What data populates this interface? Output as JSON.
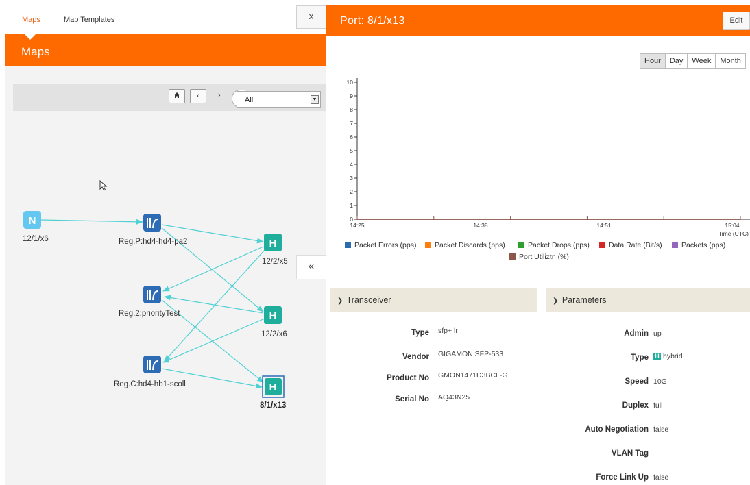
{
  "nav": {
    "tabs": [
      {
        "label": "Maps"
      },
      {
        "label": "Map Templates"
      }
    ]
  },
  "maps_header": {
    "title": "Maps"
  },
  "map_toolbar": {
    "home_icon": "home-icon",
    "prev_icon": "chevron-left-icon",
    "next_icon": "chevron-right-icon",
    "filter_value": "All"
  },
  "map": {
    "nodes": [
      {
        "label": "12/1/x6",
        "letter": "N",
        "kind": "network"
      },
      {
        "label": "Reg.P:hd4-hd4-pa2",
        "kind": "gigasmart"
      },
      {
        "label": "12/2/x5",
        "letter": "H",
        "kind": "hybrid"
      },
      {
        "label": "Reg.2:priorityTest",
        "kind": "gigasmart"
      },
      {
        "label": "12/2/x6",
        "letter": "H",
        "kind": "hybrid"
      },
      {
        "label": "Reg.C:hd4-hb1-scoll",
        "kind": "gigasmart"
      },
      {
        "label": "8/1/x13",
        "letter": "H",
        "kind": "hybrid",
        "selected": true
      }
    ],
    "colors": {
      "network": "#63c7f0",
      "gigasmart": "#2d6bb5",
      "hybrid": "#1fae9b",
      "edge": "#4fd1d4"
    }
  },
  "close_label": "x",
  "collapse_label": "«",
  "port_panel": {
    "title": "Port: 8/1/x13",
    "edit_label": "Edit",
    "ranges": [
      {
        "label": "Hour",
        "active": true
      },
      {
        "label": "Day"
      },
      {
        "label": "Week"
      },
      {
        "label": "Month"
      }
    ]
  },
  "chart_data": {
    "type": "line",
    "title": "",
    "xlabel": "Time (UTC)",
    "ylabel": "",
    "ylim": [
      0,
      10
    ],
    "y_ticks": [
      "0",
      "1",
      "2",
      "3",
      "4",
      "5",
      "6",
      "7",
      "8",
      "9",
      "10"
    ],
    "x_ticks": [
      "14:25",
      "14:38",
      "14:51",
      "15:04"
    ],
    "series": [
      {
        "name": "Packet Errors (pps)",
        "color": "#2b6cb0",
        "values": [
          0,
          0,
          0,
          0,
          0,
          0,
          0,
          0,
          0,
          0,
          0
        ]
      },
      {
        "name": "Packet Discards (pps)",
        "color": "#ff7f0e",
        "values": [
          0,
          0,
          0,
          0,
          0,
          0,
          0,
          0,
          0,
          0,
          0
        ]
      },
      {
        "name": "Packet Drops (pps)",
        "color": "#2ca02c",
        "values": [
          0,
          0,
          0,
          0,
          0,
          0,
          0,
          0,
          0,
          0,
          0
        ]
      },
      {
        "name": "Data Rate (Bit/s)",
        "color": "#d62728",
        "values": [
          0,
          0,
          0,
          0,
          0,
          0,
          0,
          0,
          0,
          0,
          0
        ]
      },
      {
        "name": "Packets (pps)",
        "color": "#9467bd",
        "values": [
          0,
          0,
          0,
          0,
          0,
          0,
          0,
          0,
          0,
          0,
          0
        ]
      },
      {
        "name": "Port Utiliztn (%)",
        "color": "#8c564b",
        "values": [
          0,
          0,
          0,
          0,
          0,
          0,
          0,
          0,
          0,
          0,
          0
        ]
      }
    ]
  },
  "transceiver": {
    "title": "Transceiver",
    "fields": [
      {
        "key": "Type",
        "value": "sfp+ lr"
      },
      {
        "key": "Vendor",
        "value": "GIGAMON SFP-533"
      },
      {
        "key": "Product No",
        "value": "GMON1471D3BCL-G"
      },
      {
        "key": "Serial No",
        "value": "AQ43N25"
      }
    ]
  },
  "parameters": {
    "title": "Parameters",
    "fields": [
      {
        "key": "Admin",
        "value": "up"
      },
      {
        "key": "Type",
        "value": "hybrid",
        "badge": "H"
      },
      {
        "key": "Speed",
        "value": "10G"
      },
      {
        "key": "Duplex",
        "value": "full"
      },
      {
        "key": "Auto Negotiation",
        "value": "false"
      },
      {
        "key": "VLAN Tag",
        "value": ""
      },
      {
        "key": "Force Link Up",
        "value": "false"
      }
    ]
  }
}
